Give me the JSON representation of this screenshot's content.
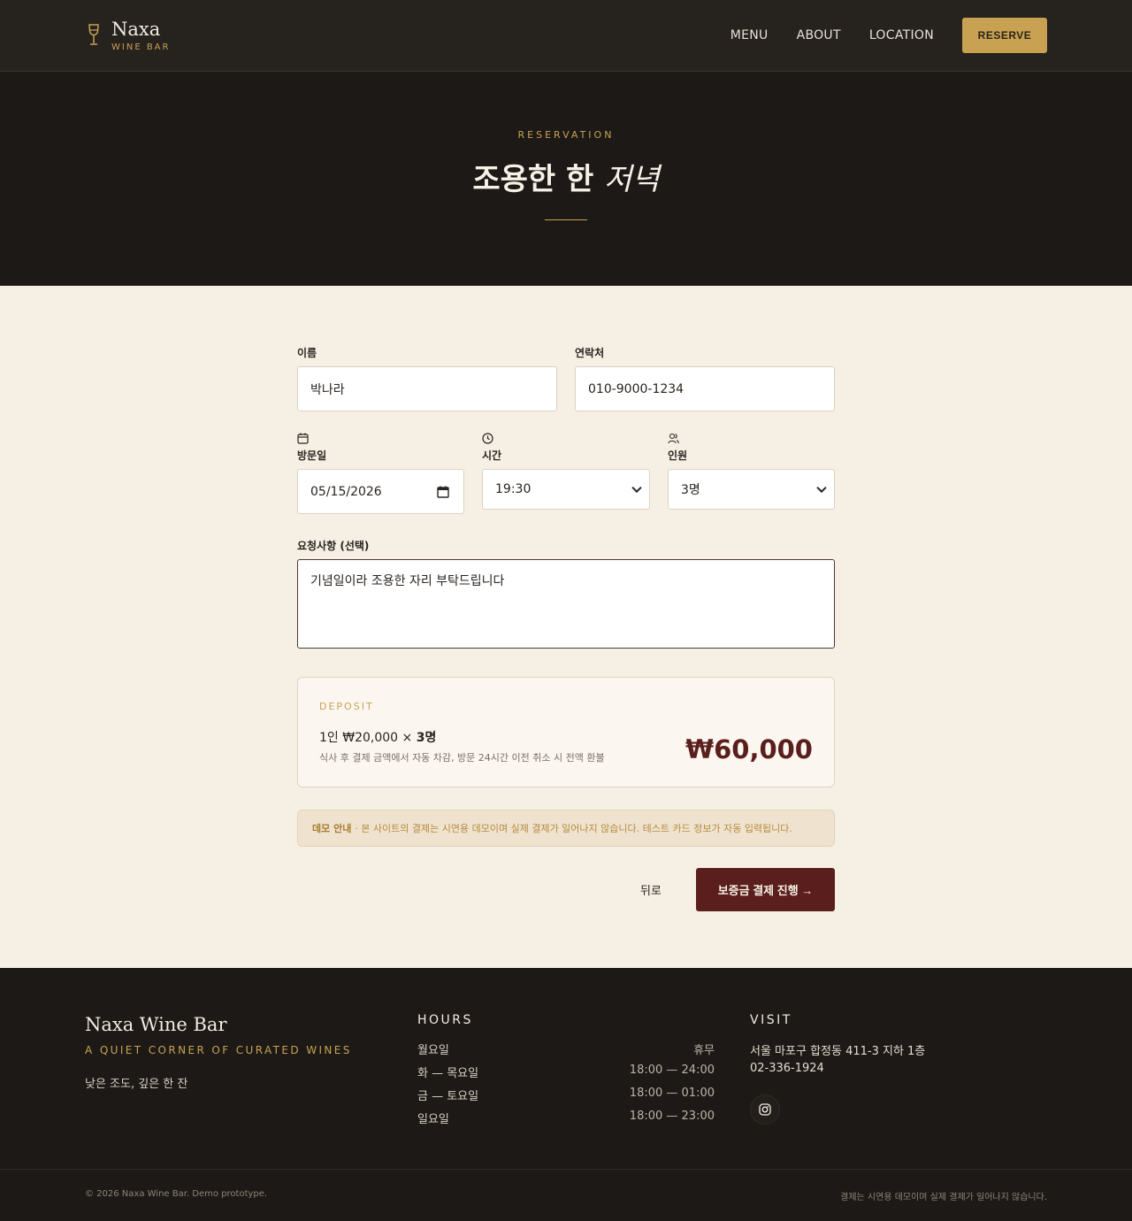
{
  "header": {
    "brand_name": "Naxa",
    "brand_sub": "WINE BAR",
    "nav": [
      "MENU",
      "ABOUT",
      "LOCATION"
    ],
    "reserve_label": "RESERVE"
  },
  "hero": {
    "eyebrow": "RESERVATION",
    "title_main": "조용한 한",
    "title_em": "저녁"
  },
  "form": {
    "name": {
      "label": "이름",
      "value": "박나라"
    },
    "phone": {
      "label": "연락처",
      "value": "010-9000-1234"
    },
    "date": {
      "label": "방문일",
      "value": "05/15/2026"
    },
    "time": {
      "label": "시간",
      "value": "19:30"
    },
    "party": {
      "label": "인원",
      "value": "3명"
    },
    "request": {
      "label": "요청사항 (선택)",
      "value": "기념일이라 조용한 자리 부탁드립니다"
    }
  },
  "deposit": {
    "eyebrow": "DEPOSIT",
    "per_person": "1인 ₩20,000 ×",
    "count": "3명",
    "note": "식사 후 결제 금액에서 자동 차감, 방문 24시간 이전 취소 시 전액 환불",
    "amount": "₩60,000"
  },
  "notice": {
    "title": "데모 안내",
    "text": "· 본 사이트의 결제는 시연용 데모이며 실제 결제가 일어나지 않습니다. 테스트 카드 정보가 자동 입력됩니다."
  },
  "actions": {
    "back_label": "뒤로",
    "pay_label": "보증금 결제 진행 →"
  },
  "footer": {
    "brand": "Naxa Wine Bar",
    "tagline": "A QUIET CORNER OF CURATED WINES",
    "quote": "낮은 조도, 깊은 한 잔",
    "hours_title": "HOURS",
    "hours": [
      {
        "day": "월요일",
        "time": "휴무"
      },
      {
        "day": "화 — 목요일",
        "time": "18:00 — 24:00"
      },
      {
        "day": "금 — 토요일",
        "time": "18:00 — 01:00"
      },
      {
        "day": "일요일",
        "time": "18:00 — 23:00"
      }
    ],
    "visit_title": "VISIT",
    "address": "서울 마포구 합정동 411-3 지하 1층",
    "phone": "02-336-1924",
    "copyright": "© 2026 Naxa Wine Bar. Demo prototype.",
    "disclaimer": "결제는 시연용 데모이며 실제 결제가 일어나지 않습니다."
  },
  "icons": {
    "brand": "wine-glass-icon",
    "date": "calendar-icon",
    "time": "clock-icon",
    "party": "users-icon",
    "social": "instagram-icon"
  },
  "colors": {
    "gold": "#c9a153",
    "burgundy": "#5a1e1c",
    "dark": "#1c1916",
    "cream": "#f5efe4"
  }
}
